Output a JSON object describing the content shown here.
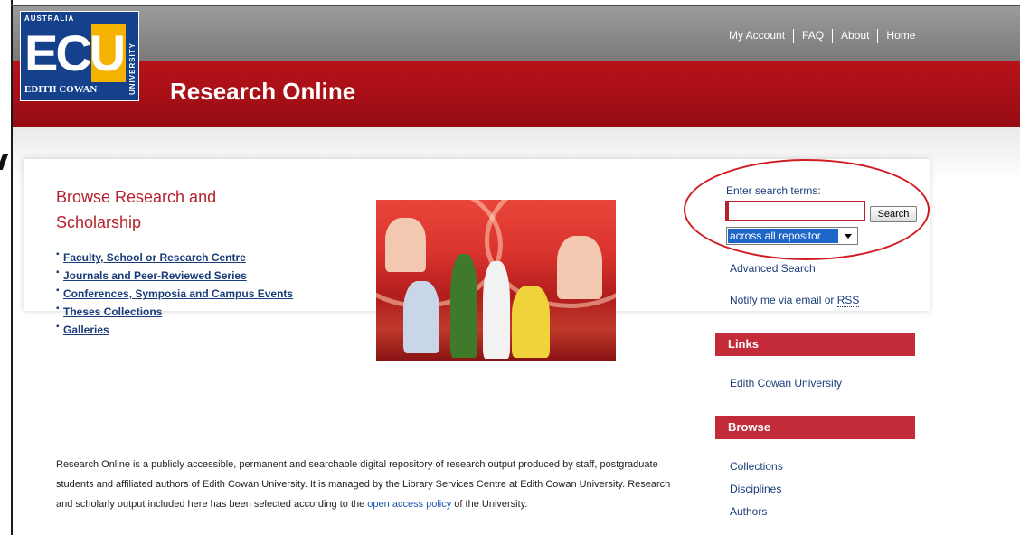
{
  "header": {
    "site_title": "Research Online",
    "top_links": [
      "My Account",
      "FAQ",
      "About",
      "Home"
    ]
  },
  "logo": {
    "country": "AUSTRALIA",
    "initials": "ECU",
    "name": "EDITH COWAN",
    "vertical": "UNIVERSITY"
  },
  "browse": {
    "heading": "Browse Research and Scholarship",
    "items": [
      "Faculty, School or Research Centre",
      "Journals and Peer-Reviewed Series",
      "Conferences, Symposia and Campus Events",
      "Theses Collections",
      "Galleries"
    ]
  },
  "search": {
    "label": "Enter search terms:",
    "input_value": "",
    "button_label": "Search",
    "scope_selected": "across all repositor",
    "advanced_label": "Advanced Search",
    "notify_text": "Notify me via email or ",
    "rss_label": "RSS"
  },
  "links_section": {
    "title": "Links",
    "items": [
      "Edith Cowan University"
    ]
  },
  "browse_section": {
    "title": "Browse",
    "items": [
      "Collections",
      "Disciplines",
      "Authors"
    ]
  },
  "about": {
    "text_part1": "Research Online is a publicly accessible, permanent and searchable digital repository of research output produced by staff, postgraduate students and affiliated authors of Edith Cowan University. It is managed by the Library Services Centre at Edith Cowan University. Research and scholarly output included here has been selected according to the ",
    "link_label": "open access policy",
    "text_part2": " of the University."
  },
  "colors": {
    "header_red": "#a50f16",
    "header_gray": "#8a8a8a",
    "accent_red": "#c32b39",
    "link_blue": "#1a3d7a",
    "annotation_red": "#d21c24"
  }
}
